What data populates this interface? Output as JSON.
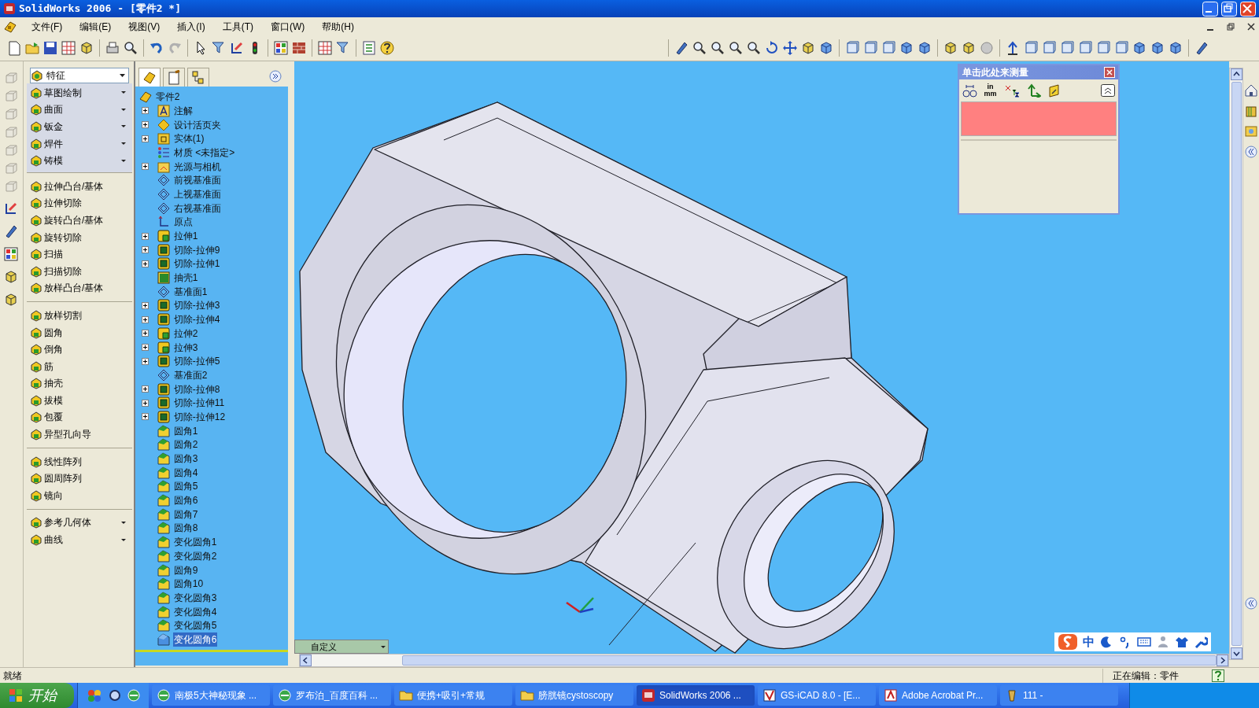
{
  "window": {
    "title": "SolidWorks 2006 - [零件2 *]"
  },
  "menu": [
    "文件(F)",
    "编辑(E)",
    "视图(V)",
    "插入(I)",
    "工具(T)",
    "窗口(W)",
    "帮助(H)"
  ],
  "command_manager": {
    "selector": "特征",
    "groups": [
      [
        {
          "label": "草图绘制",
          "dropdown": true
        },
        {
          "label": "曲面",
          "dropdown": true
        },
        {
          "label": "钣金",
          "dropdown": true
        },
        {
          "label": "焊件",
          "dropdown": true
        },
        {
          "label": "铸模",
          "dropdown": true
        }
      ],
      [
        {
          "label": "拉伸凸台/基体",
          "dropdown": false
        },
        {
          "label": "拉伸切除",
          "dropdown": false
        },
        {
          "label": "旋转凸台/基体",
          "dropdown": false
        },
        {
          "label": "旋转切除",
          "dropdown": false
        },
        {
          "label": "扫描",
          "dropdown": false
        },
        {
          "label": "扫描切除",
          "dropdown": false
        },
        {
          "label": "放样凸台/基体",
          "dropdown": false
        }
      ],
      [
        {
          "label": "放样切割",
          "dropdown": false
        },
        {
          "label": "圆角",
          "dropdown": false
        },
        {
          "label": "倒角",
          "dropdown": false
        },
        {
          "label": "筋",
          "dropdown": false
        },
        {
          "label": "抽壳",
          "dropdown": false
        },
        {
          "label": "拔模",
          "dropdown": false
        },
        {
          "label": "包覆",
          "dropdown": false
        },
        {
          "label": "异型孔向导",
          "dropdown": false
        }
      ],
      [
        {
          "label": "线性阵列",
          "dropdown": false
        },
        {
          "label": "圆周阵列",
          "dropdown": false
        },
        {
          "label": "镜向",
          "dropdown": false
        }
      ],
      [
        {
          "label": "参考几何体",
          "dropdown": true
        },
        {
          "label": "曲线",
          "dropdown": true
        }
      ]
    ]
  },
  "panel_tabs": [
    {
      "selected": true
    },
    {
      "selected": false
    },
    {
      "selected": false
    }
  ],
  "feature_tree": {
    "root": "零件2",
    "items": [
      {
        "label": "注解",
        "kind": "annotation",
        "expandable": true,
        "selected": false
      },
      {
        "label": "设计活页夹",
        "kind": "binder",
        "expandable": true,
        "selected": false
      },
      {
        "label": "实体(1)",
        "kind": "folder",
        "expandable": true,
        "selected": false
      },
      {
        "label": "材质 <未指定>",
        "kind": "material",
        "expandable": false,
        "selected": false
      },
      {
        "label": "光源与相机",
        "kind": "lights",
        "expandable": true,
        "selected": false
      },
      {
        "label": "前视基准面",
        "kind": "plane",
        "expandable": false,
        "selected": false
      },
      {
        "label": "上视基准面",
        "kind": "plane",
        "expandable": false,
        "selected": false
      },
      {
        "label": "右视基准面",
        "kind": "plane",
        "expandable": false,
        "selected": false
      },
      {
        "label": "原点",
        "kind": "origin",
        "expandable": false,
        "selected": false
      },
      {
        "label": "拉伸1",
        "kind": "boss",
        "expandable": true,
        "selected": false
      },
      {
        "label": "切除-拉伸9",
        "kind": "cut",
        "expandable": true,
        "selected": false
      },
      {
        "label": "切除-拉伸1",
        "kind": "cut",
        "expandable": true,
        "selected": false
      },
      {
        "label": "抽壳1",
        "kind": "shell",
        "expandable": false,
        "selected": false
      },
      {
        "label": "基准面1",
        "kind": "plane",
        "expandable": false,
        "selected": false
      },
      {
        "label": "切除-拉伸3",
        "kind": "cut",
        "expandable": true,
        "selected": false
      },
      {
        "label": "切除-拉伸4",
        "kind": "cut",
        "expandable": true,
        "selected": false
      },
      {
        "label": "拉伸2",
        "kind": "boss",
        "expandable": true,
        "selected": false
      },
      {
        "label": "拉伸3",
        "kind": "boss",
        "expandable": true,
        "selected": false
      },
      {
        "label": "切除-拉伸5",
        "kind": "cut",
        "expandable": true,
        "selected": false
      },
      {
        "label": "基准面2",
        "kind": "plane",
        "expandable": false,
        "selected": false
      },
      {
        "label": "切除-拉伸8",
        "kind": "cut",
        "expandable": true,
        "selected": false
      },
      {
        "label": "切除-拉伸11",
        "kind": "cut",
        "expandable": true,
        "selected": false
      },
      {
        "label": "切除-拉伸12",
        "kind": "cut",
        "expandable": true,
        "selected": false
      },
      {
        "label": "圆角1",
        "kind": "fillet",
        "expandable": false,
        "selected": false
      },
      {
        "label": "圆角2",
        "kind": "fillet",
        "expandable": false,
        "selected": false
      },
      {
        "label": "圆角3",
        "kind": "fillet",
        "expandable": false,
        "selected": false
      },
      {
        "label": "圆角4",
        "kind": "fillet",
        "expandable": false,
        "selected": false
      },
      {
        "label": "圆角5",
        "kind": "fillet",
        "expandable": false,
        "selected": false
      },
      {
        "label": "圆角6",
        "kind": "fillet",
        "expandable": false,
        "selected": false
      },
      {
        "label": "圆角7",
        "kind": "fillet",
        "expandable": false,
        "selected": false
      },
      {
        "label": "圆角8",
        "kind": "fillet",
        "expandable": false,
        "selected": false
      },
      {
        "label": "变化圆角1",
        "kind": "fillet",
        "expandable": false,
        "selected": false
      },
      {
        "label": "变化圆角2",
        "kind": "fillet",
        "expandable": false,
        "selected": false
      },
      {
        "label": "圆角9",
        "kind": "fillet",
        "expandable": false,
        "selected": false
      },
      {
        "label": "圆角10",
        "kind": "fillet",
        "expandable": false,
        "selected": false
      },
      {
        "label": "变化圆角3",
        "kind": "fillet",
        "expandable": false,
        "selected": false
      },
      {
        "label": "变化圆角4",
        "kind": "fillet",
        "expandable": false,
        "selected": false
      },
      {
        "label": "变化圆角5",
        "kind": "fillet",
        "expandable": false,
        "selected": false
      },
      {
        "label": "变化圆角6",
        "kind": "fillet",
        "expandable": false,
        "selected": true
      }
    ]
  },
  "measure_panel": {
    "title": "单击此处来测量",
    "units": [
      "in",
      "mm"
    ]
  },
  "viewport": {
    "view_selector": "自定义"
  },
  "ime": {
    "mode": "中"
  },
  "status_bar": {
    "left": "就绪",
    "right": "正在编辑：零件"
  },
  "taskbar": {
    "start": "开始",
    "tasks": [
      {
        "label": "南极5大神秘现象 ...",
        "kind": "browser",
        "selected": false
      },
      {
        "label": "罗布泊_百度百科 ...",
        "kind": "browser",
        "selected": false
      },
      {
        "label": "便携+吸引+常规",
        "kind": "folder",
        "selected": false
      },
      {
        "label": "膀胱镜cystoscopy",
        "kind": "folder",
        "selected": false
      },
      {
        "label": "SolidWorks 2006 ...",
        "kind": "cad",
        "selected": true
      },
      {
        "label": "GS-iCAD 8.0 - [E...",
        "kind": "document",
        "selected": false
      },
      {
        "label": "Adobe Acrobat Pr...",
        "kind": "pdf",
        "selected": false
      },
      {
        "label": "111 -",
        "kind": "app",
        "selected": false
      }
    ]
  }
}
